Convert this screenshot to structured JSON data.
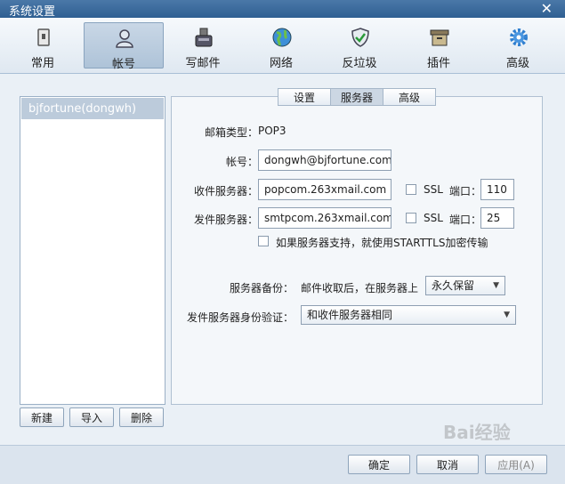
{
  "window": {
    "title": "系统设置",
    "close": "✕"
  },
  "toolbar": {
    "items": [
      {
        "label": "常用",
        "icon": "general-icon"
      },
      {
        "label": "帐号",
        "icon": "account-icon"
      },
      {
        "label": "写邮件",
        "icon": "compose-icon"
      },
      {
        "label": "网络",
        "icon": "network-icon"
      },
      {
        "label": "反垃圾",
        "icon": "antispam-shield-icon"
      },
      {
        "label": "插件",
        "icon": "plugin-box-icon"
      },
      {
        "label": "高级",
        "icon": "advanced-gear-icon"
      }
    ],
    "active_index": 1
  },
  "accounts": {
    "items": [
      "bjfortune(dongwh)"
    ],
    "selected_index": 0
  },
  "account_buttons": {
    "new": "新建",
    "import": "导入",
    "delete": "删除"
  },
  "tabs": {
    "items": [
      "设置",
      "服务器",
      "高级"
    ],
    "active_index": 1
  },
  "server": {
    "mailbox_type_label": "邮箱类型：",
    "mailbox_type_value": "POP3",
    "account_label": "帐号：",
    "account_value": "dongwh@bjfortune.com",
    "incoming_label": "收件服务器：",
    "incoming_value": "popcom.263xmail.com",
    "incoming_ssl_label": "SSL",
    "incoming_ssl_checked": false,
    "incoming_port_label": "端口：",
    "incoming_port_value": "110",
    "outgoing_label": "发件服务器：",
    "outgoing_value": "smtpcom.263xmail.com",
    "outgoing_ssl_label": "SSL",
    "outgoing_ssl_checked": false,
    "outgoing_port_label": "端口：",
    "outgoing_port_value": "25",
    "starttls_label": "如果服务器支持，就使用STARTTLS加密传输",
    "starttls_checked": false,
    "backup_label": "服务器备份：",
    "backup_desc": "邮件收取后，在服务器上",
    "backup_value": "永久保留",
    "smtp_auth_label": "发件服务器身份验证：",
    "smtp_auth_value": "和收件服务器相同"
  },
  "dialog_buttons": {
    "ok": "确定",
    "cancel": "取消",
    "apply": "应用(A)"
  },
  "watermark": "Bai经验",
  "colors": {
    "titlebar": "#2f5f92",
    "selected": "#bccbdb",
    "panel": "#eaf0f6"
  }
}
